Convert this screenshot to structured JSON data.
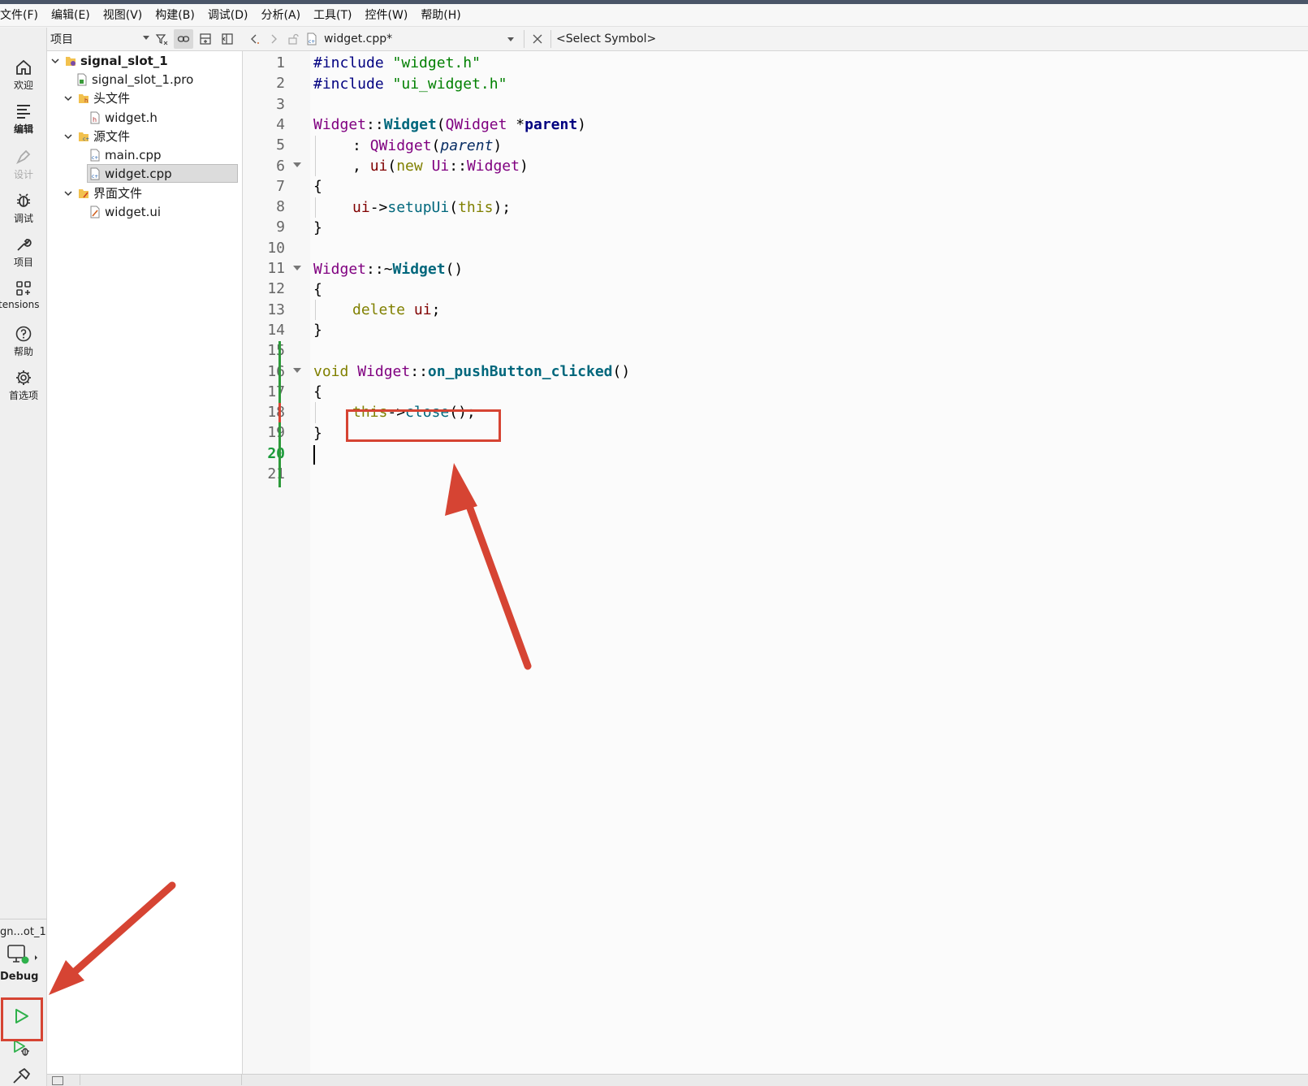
{
  "menubar": {
    "items": [
      "文件(F)",
      "编辑(E)",
      "视图(V)",
      "构建(B)",
      "调试(D)",
      "分析(A)",
      "工具(T)",
      "控件(W)",
      "帮助(H)"
    ]
  },
  "modes": {
    "welcome": "欢迎",
    "edit": "编辑",
    "design": "设计",
    "debug": "调试",
    "projects": "项目",
    "extensions": "tensions",
    "help": "帮助",
    "preferences": "首选项"
  },
  "kit": {
    "project": "gn...ot_1",
    "build_config": "Debug"
  },
  "project_panel": {
    "view_select": "项目",
    "tree": [
      {
        "label": "signal_slot_1"
      },
      {
        "label": "signal_slot_1.pro"
      },
      {
        "label": "头文件"
      },
      {
        "label": "widget.h"
      },
      {
        "label": "源文件"
      },
      {
        "label": "main.cpp"
      },
      {
        "label": "widget.cpp"
      },
      {
        "label": "界面文件"
      },
      {
        "label": "widget.ui"
      }
    ]
  },
  "editor": {
    "file_combo": "widget.cpp*",
    "symbol_combo": "<Select Symbol>",
    "line_numbers": [
      "1",
      "2",
      "3",
      "4",
      "5",
      "6",
      "7",
      "8",
      "9",
      "10",
      "11",
      "12",
      "13",
      "14",
      "15",
      "16",
      "17",
      "18",
      "19",
      "20",
      "21"
    ],
    "current_line": "20",
    "code": {
      "l1_directive": "#include",
      "l1_string": "\"widget.h\"",
      "l2_directive": "#include",
      "l2_string": "\"ui_widget.h\"",
      "l4_class": "Widget",
      "l4_sep": "::",
      "l4_ctor": "Widget",
      "l4_open": "(",
      "l4_type": "QWidget",
      "l4_star": " *",
      "l4_param": "parent",
      "l4_close": ")",
      "l5_colon": ": ",
      "l5_base": "QWidget",
      "l5_open": "(",
      "l5_arg": "parent",
      "l5_close": ")",
      "l6_comma": ", ",
      "l6_member": "ui",
      "l6_open": "(",
      "l6_new": "new",
      "l6_ns": "Ui",
      "l6_sep": "::",
      "l6_type": "Widget",
      "l6_close": ")",
      "l7": "{",
      "l8_member": "ui",
      "l8_arrow": "->",
      "l8_call": "setupUi",
      "l8_open": "(",
      "l8_this": "this",
      "l8_close": ");",
      "l9": "}",
      "l11_class": "Widget",
      "l11_sep": "::~",
      "l11_dtor": "Widget",
      "l11_parens": "()",
      "l12": "{",
      "l13_delete": "delete",
      "l13_member": "ui",
      "l13_semi": ";",
      "l14": "}",
      "l16_void": "void",
      "l16_class": "Widget",
      "l16_sep": "::",
      "l16_fn": "on_pushButton_clicked",
      "l16_parens": "()",
      "l17": "{",
      "l18_this": "this",
      "l18_arrow": "->",
      "l18_call": "close",
      "l18_rest": "();",
      "l19": "}"
    }
  },
  "colors": {
    "annotation_red": "#d64433",
    "keyword": "#808000",
    "type": "#800080",
    "function": "#00677c",
    "string": "#008000",
    "current_line_number": "#1a9a3a"
  }
}
